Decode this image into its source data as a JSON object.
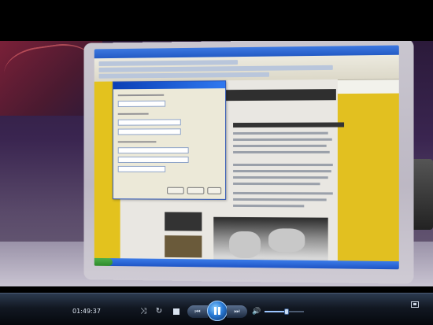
{
  "player": {
    "time_elapsed": "01:49:37",
    "volume_level": 0.55,
    "is_playing": true
  },
  "icons": {
    "shuffle": "shuffle-icon",
    "repeat": "repeat-icon",
    "stop": "stop-icon",
    "previous": "previous-icon",
    "play_pause": "pause-icon",
    "next": "next-icon",
    "mute": "speaker-icon",
    "fullscreen": "fullscreen-icon"
  },
  "glyphs": {
    "shuffle": "⤨",
    "repeat": "↻",
    "previous": "⏮",
    "next": "⏭",
    "mute": "🔊"
  },
  "colors": {
    "accent": "#2a7bd6",
    "mute_indicator": "#ff6b6b"
  }
}
